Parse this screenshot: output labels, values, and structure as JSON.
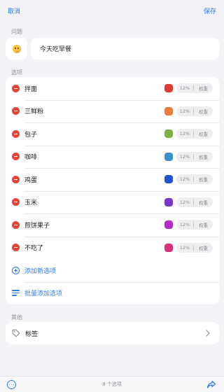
{
  "topbar": {
    "cancel": "取消",
    "save": "保存"
  },
  "question": {
    "section_label": "问题",
    "text": "今天吃早餐",
    "emoji": "thinking-face-icon"
  },
  "options": {
    "section_label": "选项",
    "items": [
      {
        "label": "拌面",
        "color": "#e03b36",
        "percent": "12%",
        "weight": "权重"
      },
      {
        "label": "三鲜粉",
        "color": "#ef7a3e",
        "percent": "12%",
        "weight": "权重"
      },
      {
        "label": "包子",
        "color": "#7fb142",
        "percent": "12%",
        "weight": "权重"
      },
      {
        "label": "咖啡",
        "color": "#3a8fc8",
        "percent": "12%",
        "weight": "权重"
      },
      {
        "label": "鸡蛋",
        "color": "#2152d6",
        "percent": "12%",
        "weight": "权重"
      },
      {
        "label": "玉米",
        "color": "#7a37cf",
        "percent": "12%",
        "weight": "权重"
      },
      {
        "label": "煎饼果子",
        "color": "#b72cc7",
        "percent": "12%",
        "weight": "权重"
      },
      {
        "label": "不吃了",
        "color": "#d9317a",
        "percent": "12%",
        "weight": "权重"
      }
    ],
    "add_option": "添加新选项",
    "batch_add": "批量添加选项"
  },
  "other": {
    "section_label": "其他",
    "tags_label": "标签"
  },
  "bottombar": {
    "count": "8 个选项"
  },
  "colors": {
    "accent": "#2d7cf6",
    "delete": "#e84336"
  }
}
